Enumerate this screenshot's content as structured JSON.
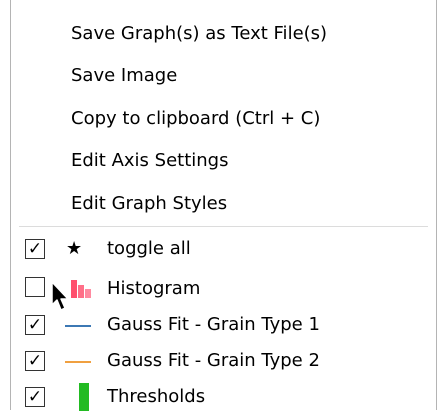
{
  "menu": {
    "actions": [
      {
        "label": "Save Graph(s) as Text File(s)"
      },
      {
        "label": "Save Image"
      },
      {
        "label": "Copy to clipboard (Ctrl + C)"
      },
      {
        "label": "Edit Axis Settings"
      },
      {
        "label": "Edit Graph Styles"
      }
    ],
    "toggles": [
      {
        "label": "toggle all",
        "checked": true,
        "icon": "star-icon",
        "color": "#000000"
      },
      {
        "label": "Histogram",
        "checked": false,
        "icon": "histogram-icon",
        "color": "#ff4f6d"
      },
      {
        "label": "Gauss Fit - Grain Type 1",
        "checked": true,
        "icon": "line-icon",
        "color": "#3c78b4"
      },
      {
        "label": "Gauss Fit - Grain Type 2",
        "checked": true,
        "icon": "line-icon",
        "color": "#f0a040"
      },
      {
        "label": "Thresholds",
        "checked": true,
        "icon": "bar-icon",
        "color": "#22bb22"
      }
    ],
    "check_glyph": "✓",
    "star_glyph": "★"
  }
}
